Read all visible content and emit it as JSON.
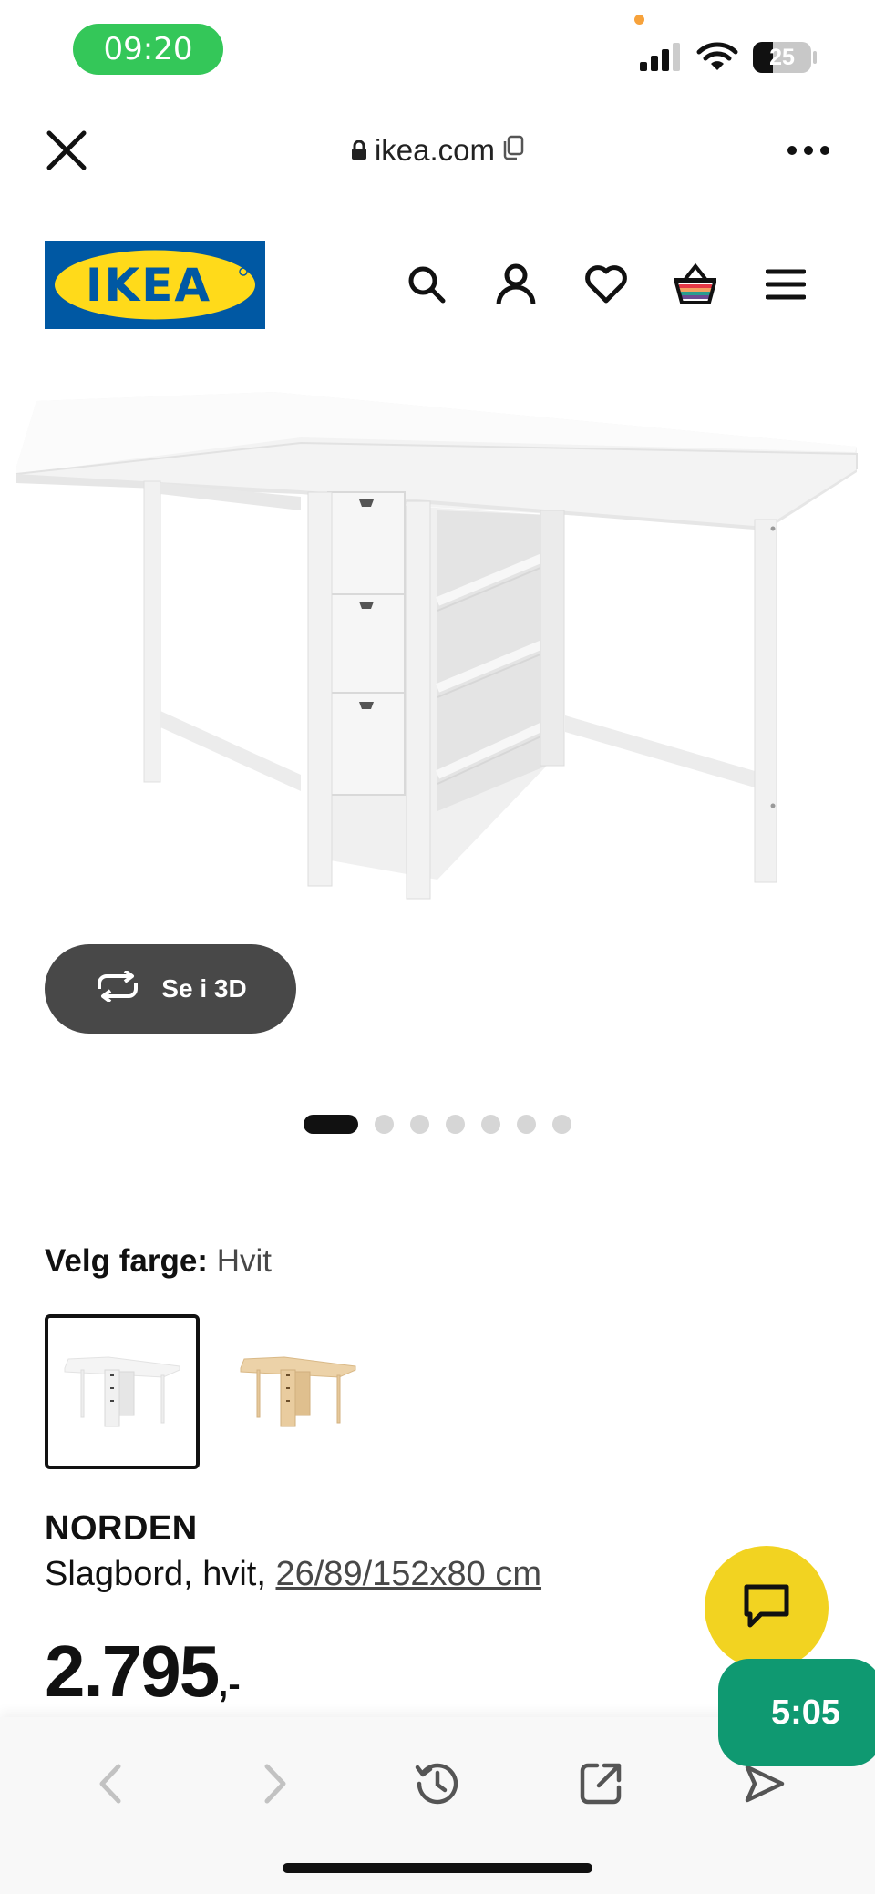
{
  "status_bar": {
    "time": "09:20",
    "battery": "25"
  },
  "browser": {
    "domain": "ikea.com"
  },
  "header": {
    "logo_text": "IKEA"
  },
  "product_view": {
    "button_3d_label": "Se i 3D",
    "carousel": {
      "total": 7,
      "active_index": 0
    }
  },
  "color_picker": {
    "label": "Velg farge:",
    "selected_value": "Hvit",
    "options": [
      {
        "name": "white-table-swatch",
        "selected": true,
        "color": "#ffffff"
      },
      {
        "name": "birch-table-swatch",
        "selected": false,
        "color": "#e8cfa8"
      }
    ]
  },
  "product": {
    "name": "NORDEN",
    "description": "Slagbord, hvit,",
    "dimensions": "26/89/152x80 cm",
    "price_main": "2.795",
    "price_suffix": ",-"
  },
  "floating": {
    "timer": "5:05"
  },
  "colors": {
    "ikea_blue": "#0058a3",
    "ikea_yellow": "#ffda1a",
    "chat_yellow": "#f2d321",
    "timer_green": "#0f9971",
    "status_green": "#34c759"
  }
}
